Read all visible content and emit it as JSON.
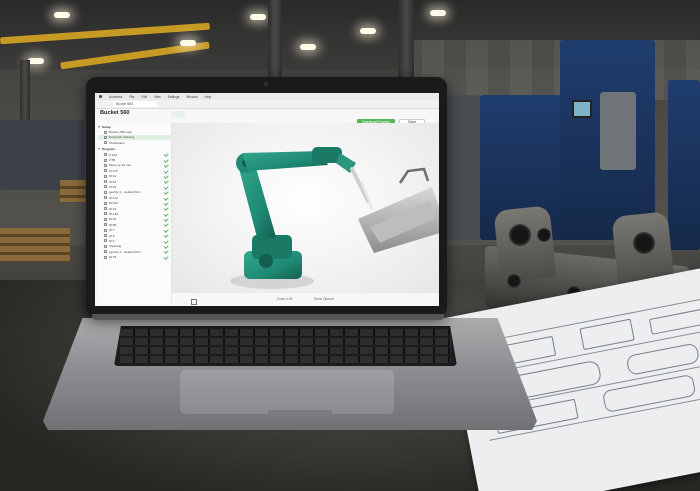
{
  "app": {
    "menu": [
      "Autodesk",
      "File",
      "Edit",
      "View",
      "Settings",
      "Window",
      "Help"
    ],
    "tab_label": "Bucket 560",
    "project_title": "Bucket 560",
    "download_button": "Download Program",
    "share_button": "Share",
    "status": {
      "left": "Zoom to fit",
      "right": "Show Options"
    },
    "tree": {
      "setup_group": "Setup",
      "setup_items": [
        "Bucket_560.step",
        "Robotcell ordering",
        "Toolholders"
      ],
      "program_group": "Program",
      "program_items": [
        "Z:100",
        "Z:55",
        "Move up 10 mm",
        "W:113",
        "W:12",
        "W:19",
        "W:22",
        "geoVle 1 - welded brim",
        "W:172",
        "W:101",
        "W:21",
        "W:120",
        "W:94",
        "W:88",
        "W:7",
        "W:6",
        "W:4",
        "Cleaning",
        "geoVle 2 - welded brim",
        "W:79"
      ]
    }
  },
  "colors": {
    "accent_green": "#59b35b",
    "robot_teal": "#1f8a74",
    "selected_row": "#dff0e2"
  }
}
